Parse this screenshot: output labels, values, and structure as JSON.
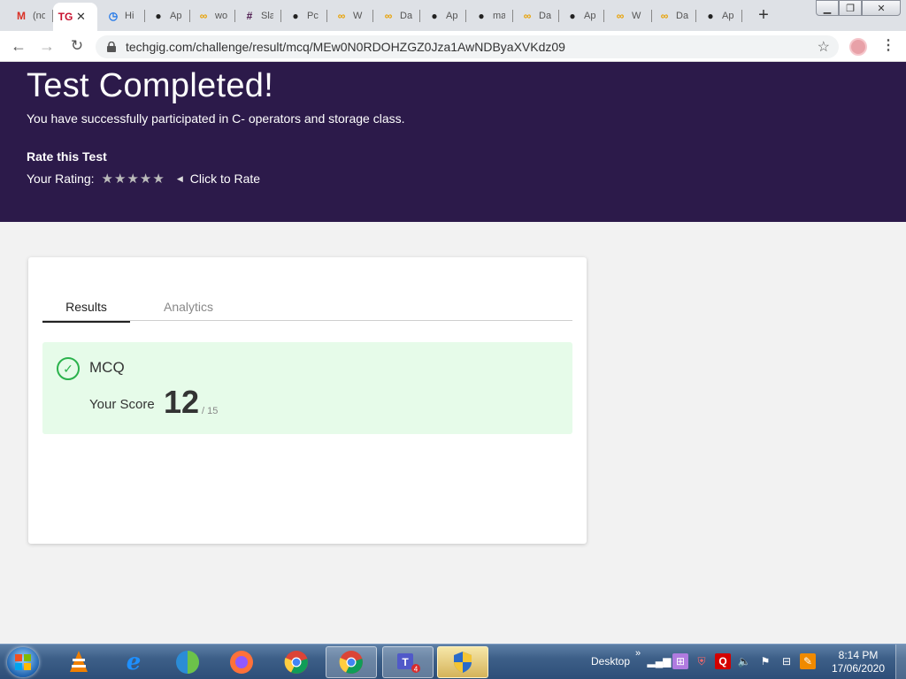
{
  "browser": {
    "tabs": [
      {
        "title": "(no",
        "icon": "gmail-icon",
        "glyph": "M",
        "color": "#d93025"
      },
      {
        "title": "TG",
        "icon": "techgig-icon",
        "glyph": "TG",
        "color": "#c8102e",
        "active": true
      },
      {
        "title": "Hi",
        "icon": "history-icon",
        "glyph": "◷",
        "color": "#1a73e8"
      },
      {
        "title": "Ap",
        "icon": "github-icon",
        "glyph": "●",
        "color": "#222"
      },
      {
        "title": "wo",
        "icon": "loop-icon",
        "glyph": "∞",
        "color": "#e8a000"
      },
      {
        "title": "Sla",
        "icon": "slack-icon",
        "glyph": "#",
        "color": "#4a154b"
      },
      {
        "title": "Pc",
        "icon": "github-icon",
        "glyph": "●",
        "color": "#222"
      },
      {
        "title": "W",
        "icon": "loop-icon",
        "glyph": "∞",
        "color": "#e8a000"
      },
      {
        "title": "Da",
        "icon": "loop-icon",
        "glyph": "∞",
        "color": "#e8a000"
      },
      {
        "title": "Ap",
        "icon": "github-icon",
        "glyph": "●",
        "color": "#222"
      },
      {
        "title": "ma",
        "icon": "github-icon",
        "glyph": "●",
        "color": "#222"
      },
      {
        "title": "Da",
        "icon": "loop-icon",
        "glyph": "∞",
        "color": "#e8a000"
      },
      {
        "title": "Ap",
        "icon": "github-icon",
        "glyph": "●",
        "color": "#222"
      },
      {
        "title": "W",
        "icon": "loop-icon",
        "glyph": "∞",
        "color": "#e8a000"
      },
      {
        "title": "Da",
        "icon": "loop-icon",
        "glyph": "∞",
        "color": "#e8a000"
      },
      {
        "title": "Ap",
        "icon": "github-icon",
        "glyph": "●",
        "color": "#222"
      }
    ],
    "url": "techgig.com/challenge/result/mcq/MEw0N0RDOHZGZ0Jza1AwNDByaXVKdz09"
  },
  "hero": {
    "title": "Test Completed!",
    "subtitle": "You have successfully participated in C- operators and storage class.",
    "rate_title": "Rate this Test",
    "rating_label": "Your Rating:",
    "stars": 5,
    "star_color": "#bbbbbb",
    "click_to_rate": "Click to Rate",
    "background": "#2c1a4a"
  },
  "result": {
    "tabs": {
      "results": "Results",
      "analytics": "Analytics"
    },
    "section": "MCQ",
    "score_label": "Your Score",
    "score": "12",
    "total": "/ 15",
    "accent": "#2bb24c"
  },
  "taskbar": {
    "desktop_label": "Desktop",
    "time": "8:14 PM",
    "date": "17/06/2020"
  }
}
